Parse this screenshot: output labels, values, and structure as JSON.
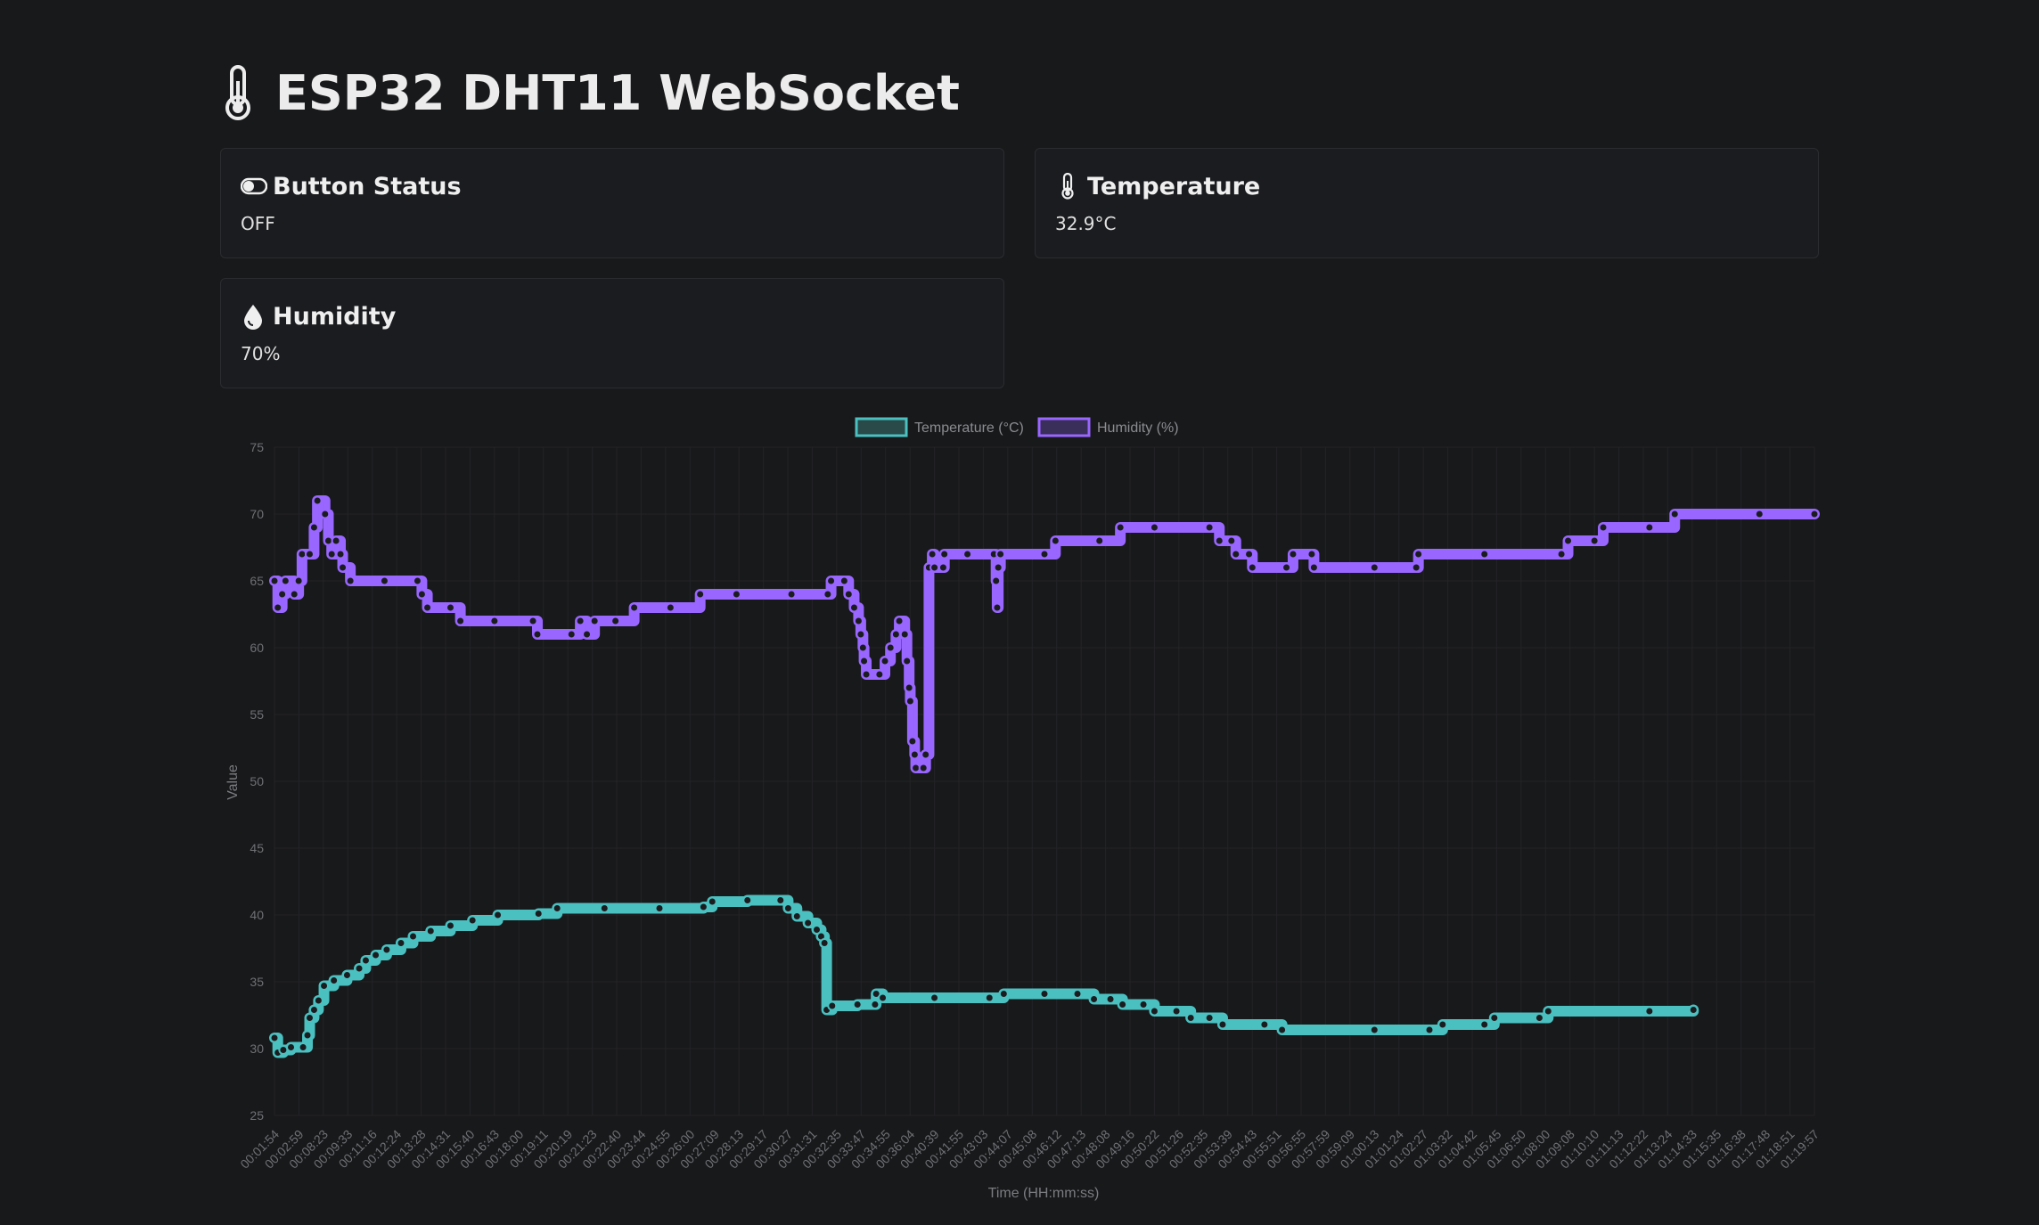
{
  "header": {
    "title": "ESP32 DHT11 WebSocket",
    "icon": "thermometer-icon"
  },
  "cards": {
    "button": {
      "title": "Button Status",
      "value": "OFF",
      "icon": "toggle-icon"
    },
    "temperature": {
      "title": "Temperature",
      "value": "32.9°C",
      "icon": "thermometer-icon"
    },
    "humidity": {
      "title": "Humidity",
      "value": "70%",
      "icon": "droplet-icon"
    }
  },
  "colors": {
    "background": "#18191b",
    "temperature": "#4bc0c0",
    "humidity": "#9966ff",
    "grid": "#232427"
  },
  "chart_data": {
    "type": "line",
    "xlabel": "Time (HH:mm:ss)",
    "ylabel": "Value",
    "ylim": [
      25,
      75
    ],
    "yticks": [
      25,
      30,
      35,
      40,
      45,
      50,
      55,
      60,
      65,
      70,
      75
    ],
    "grid": true,
    "legend_position": "top-center",
    "x_tick_labels": [
      "00:01:54",
      "00:02:59",
      "00:08:23",
      "00:09:33",
      "00:11:16",
      "00:12:24",
      "00:13:28",
      "00:14:31",
      "00:15:40",
      "00:16:43",
      "00:18:00",
      "00:19:11",
      "00:20:19",
      "00:21:23",
      "00:22:40",
      "00:23:44",
      "00:24:55",
      "00:26:00",
      "00:27:09",
      "00:28:13",
      "00:29:17",
      "00:30:27",
      "00:31:31",
      "00:32:35",
      "00:33:47",
      "00:34:55",
      "00:36:04",
      "00:40:39",
      "00:41:55",
      "00:43:03",
      "00:44:07",
      "00:45:08",
      "00:46:12",
      "00:47:13",
      "00:48:08",
      "00:49:16",
      "00:50:22",
      "00:51:26",
      "00:52:35",
      "00:53:39",
      "00:54:43",
      "00:55:51",
      "00:56:55",
      "00:57:59",
      "00:59:09",
      "01:00:13",
      "01:01:24",
      "01:02:27",
      "01:03:32",
      "01:04:42",
      "01:05:45",
      "01:06:50",
      "01:08:00",
      "01:09:08",
      "01:10:10",
      "01:11:13",
      "01:12:22",
      "01:13:24",
      "01:14:33",
      "01:15:35",
      "01:16:38",
      "01:17:48",
      "01:18:51",
      "01:19:57"
    ],
    "series": [
      {
        "name": "Temperature (°C)",
        "color": "#4bc0c0",
        "points": [
          [
            0,
            30.8
          ],
          [
            0.3,
            29.7
          ],
          [
            0.8,
            29.9
          ],
          [
            1.5,
            30.1
          ],
          [
            2.6,
            30.1
          ],
          [
            3.0,
            31.0
          ],
          [
            3.2,
            32.3
          ],
          [
            3.6,
            32.9
          ],
          [
            4.0,
            33.6
          ],
          [
            4.5,
            34.7
          ],
          [
            5.4,
            35.1
          ],
          [
            6.6,
            35.5
          ],
          [
            7.7,
            36.0
          ],
          [
            8.3,
            36.6
          ],
          [
            9.2,
            37.0
          ],
          [
            10.2,
            37.4
          ],
          [
            11.5,
            37.9
          ],
          [
            12.6,
            38.4
          ],
          [
            14.2,
            38.8
          ],
          [
            16.0,
            39.2
          ],
          [
            18.0,
            39.6
          ],
          [
            20.3,
            40.0
          ],
          [
            24.0,
            40.1
          ],
          [
            25.7,
            40.5
          ],
          [
            30.0,
            40.5
          ],
          [
            35.0,
            40.5
          ],
          [
            39.0,
            40.6
          ],
          [
            39.8,
            41.0
          ],
          [
            43.0,
            41.1
          ],
          [
            46.0,
            41.1
          ],
          [
            46.7,
            40.5
          ],
          [
            47.5,
            39.9
          ],
          [
            48.5,
            39.4
          ],
          [
            49.3,
            38.9
          ],
          [
            49.7,
            38.4
          ],
          [
            50.0,
            37.9
          ],
          [
            50.2,
            32.9
          ],
          [
            50.7,
            33.2
          ],
          [
            53.0,
            33.3
          ],
          [
            54.6,
            33.3
          ],
          [
            54.7,
            34.1
          ],
          [
            55.3,
            33.8
          ],
          [
            60.0,
            33.8
          ],
          [
            65.0,
            33.8
          ],
          [
            66.3,
            34.1
          ],
          [
            70.0,
            34.1
          ],
          [
            73.0,
            34.1
          ],
          [
            74.5,
            33.7
          ],
          [
            76.0,
            33.7
          ],
          [
            77.1,
            33.3
          ],
          [
            79.0,
            33.3
          ],
          [
            80.0,
            32.8
          ],
          [
            82.0,
            32.8
          ],
          [
            83.3,
            32.3
          ],
          [
            85.0,
            32.3
          ],
          [
            86.2,
            31.8
          ],
          [
            90.0,
            31.8
          ],
          [
            91.6,
            31.4
          ],
          [
            100.0,
            31.4
          ],
          [
            105.0,
            31.4
          ],
          [
            106.2,
            31.8
          ],
          [
            110.0,
            31.8
          ],
          [
            110.9,
            32.3
          ],
          [
            115.0,
            32.3
          ],
          [
            115.8,
            32.8
          ],
          [
            125.0,
            32.8
          ],
          [
            129.0,
            32.9
          ]
        ]
      },
      {
        "name": "Humidity (%)",
        "color": "#9966ff",
        "points": [
          [
            0,
            65
          ],
          [
            0.3,
            63
          ],
          [
            0.7,
            64
          ],
          [
            1.0,
            65
          ],
          [
            1.8,
            64
          ],
          [
            2.2,
            65
          ],
          [
            2.5,
            67
          ],
          [
            3.2,
            67
          ],
          [
            3.6,
            69
          ],
          [
            3.9,
            71
          ],
          [
            4.6,
            70
          ],
          [
            4.9,
            68
          ],
          [
            5.2,
            67
          ],
          [
            5.6,
            68
          ],
          [
            6.0,
            67
          ],
          [
            6.2,
            66
          ],
          [
            6.9,
            65
          ],
          [
            10.0,
            65
          ],
          [
            13.0,
            65
          ],
          [
            13.4,
            64
          ],
          [
            13.9,
            63
          ],
          [
            16.0,
            63
          ],
          [
            16.9,
            62
          ],
          [
            20.0,
            62
          ],
          [
            23.5,
            62
          ],
          [
            23.9,
            61
          ],
          [
            27.0,
            61
          ],
          [
            27.8,
            62
          ],
          [
            28.4,
            61
          ],
          [
            29.1,
            62
          ],
          [
            31.0,
            62
          ],
          [
            32.7,
            63
          ],
          [
            36.0,
            63
          ],
          [
            38.7,
            64
          ],
          [
            42.0,
            64
          ],
          [
            47.0,
            64
          ],
          [
            50.3,
            64
          ],
          [
            50.6,
            65
          ],
          [
            51.8,
            65
          ],
          [
            52.2,
            64
          ],
          [
            52.7,
            63
          ],
          [
            53.1,
            62
          ],
          [
            53.3,
            61
          ],
          [
            53.5,
            60
          ],
          [
            53.6,
            59
          ],
          [
            53.8,
            58
          ],
          [
            55.0,
            58
          ],
          [
            55.5,
            59
          ],
          [
            56.0,
            60
          ],
          [
            56.5,
            61
          ],
          [
            56.8,
            62
          ],
          [
            57.3,
            61
          ],
          [
            57.5,
            59
          ],
          [
            57.7,
            57
          ],
          [
            57.8,
            56
          ],
          [
            58.0,
            53
          ],
          [
            58.2,
            52
          ],
          [
            58.3,
            51
          ],
          [
            59.0,
            51
          ],
          [
            59.2,
            52
          ],
          [
            59.5,
            66
          ],
          [
            59.8,
            67
          ],
          [
            60.0,
            66
          ],
          [
            60.8,
            66
          ],
          [
            60.9,
            67
          ],
          [
            63.0,
            67
          ],
          [
            65.4,
            67
          ],
          [
            65.6,
            65
          ],
          [
            65.7,
            63
          ],
          [
            65.8,
            66
          ],
          [
            66.0,
            67
          ],
          [
            70.0,
            67
          ],
          [
            71.0,
            68
          ],
          [
            75.0,
            68
          ],
          [
            76.9,
            69
          ],
          [
            80.0,
            69
          ],
          [
            85.0,
            69
          ],
          [
            85.9,
            68
          ],
          [
            87.0,
            68
          ],
          [
            87.4,
            67
          ],
          [
            88.6,
            67
          ],
          [
            88.9,
            66
          ],
          [
            92.0,
            66
          ],
          [
            92.6,
            67
          ],
          [
            94.3,
            67
          ],
          [
            94.5,
            66
          ],
          [
            100.0,
            66
          ],
          [
            103.8,
            66
          ],
          [
            104.0,
            67
          ],
          [
            110.0,
            67
          ],
          [
            117.0,
            67
          ],
          [
            117.6,
            68
          ],
          [
            120.0,
            68
          ],
          [
            120.8,
            69
          ],
          [
            125.0,
            69
          ],
          [
            127.3,
            70
          ],
          [
            135.0,
            70
          ],
          [
            140.0,
            70
          ]
        ]
      }
    ]
  }
}
